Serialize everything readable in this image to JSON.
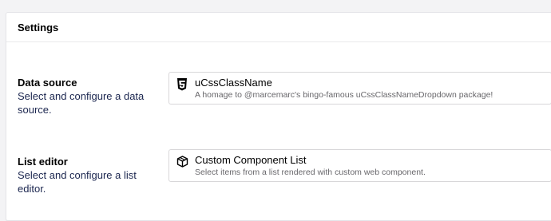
{
  "panel": {
    "title": "Settings"
  },
  "data_source": {
    "label": "Data source",
    "description": "Select and configure a data source.",
    "selected": {
      "name": "uCssClassName",
      "description": "A homage to @marcemarc's bingo-famous uCssClassNameDropdown package!",
      "icon": "css3-icon"
    }
  },
  "list_editor": {
    "label": "List editor",
    "description": "Select and configure a list editor.",
    "selected": {
      "name": "Custom Component List",
      "description": "Select items from a list rendered with custom web component.",
      "icon": "box-icon"
    }
  }
}
